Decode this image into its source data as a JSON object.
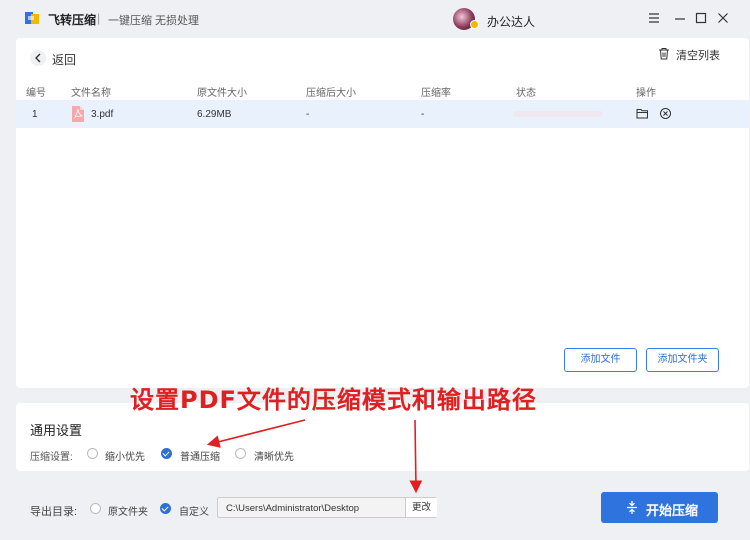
{
  "titlebar": {
    "app_name": "飞转压缩",
    "separator": "|",
    "subtitle": "一键压缩 无损处理",
    "username": "办公达人"
  },
  "toolbar": {
    "back_label": "返回",
    "clear_label": "清空列表"
  },
  "table": {
    "headers": [
      "编号",
      "文件名称",
      "原文件大小",
      "压缩后大小",
      "压缩率",
      "状态",
      "操作"
    ],
    "rows": [
      {
        "index": "1",
        "name": "3.pdf",
        "original_size": "6.29MB",
        "compressed_size": "-",
        "ratio": "-",
        "status": ""
      }
    ]
  },
  "buttons": {
    "add_file": "添加文件",
    "add_folder": "添加文件夹",
    "start": "开始压缩",
    "change": "更改"
  },
  "annotation": "设置PDF文件的压缩模式和输出路径",
  "settings": {
    "title": "通用设置",
    "compress_label": "压缩设置:",
    "options": [
      {
        "label": "缩小优先",
        "selected": false
      },
      {
        "label": "普通压缩",
        "selected": true
      },
      {
        "label": "清晰优先",
        "selected": false
      }
    ]
  },
  "output": {
    "label": "导出目录:",
    "options": [
      {
        "label": "原文件夹",
        "selected": false
      },
      {
        "label": "自定义",
        "selected": true
      }
    ],
    "path": "C:\\Users\\Administrator\\Desktop"
  },
  "colors": {
    "accent": "#2e73de",
    "annotation_red": "#e02020",
    "row_highlight": "#e8f1fc"
  },
  "icons": {
    "logo": "app-logo-icon",
    "back": "chevron-left-icon",
    "clear": "trash-icon",
    "file": "pdf-file-icon",
    "open_folder": "folder-icon",
    "remove": "close-circle-icon",
    "start": "compress-icon"
  }
}
